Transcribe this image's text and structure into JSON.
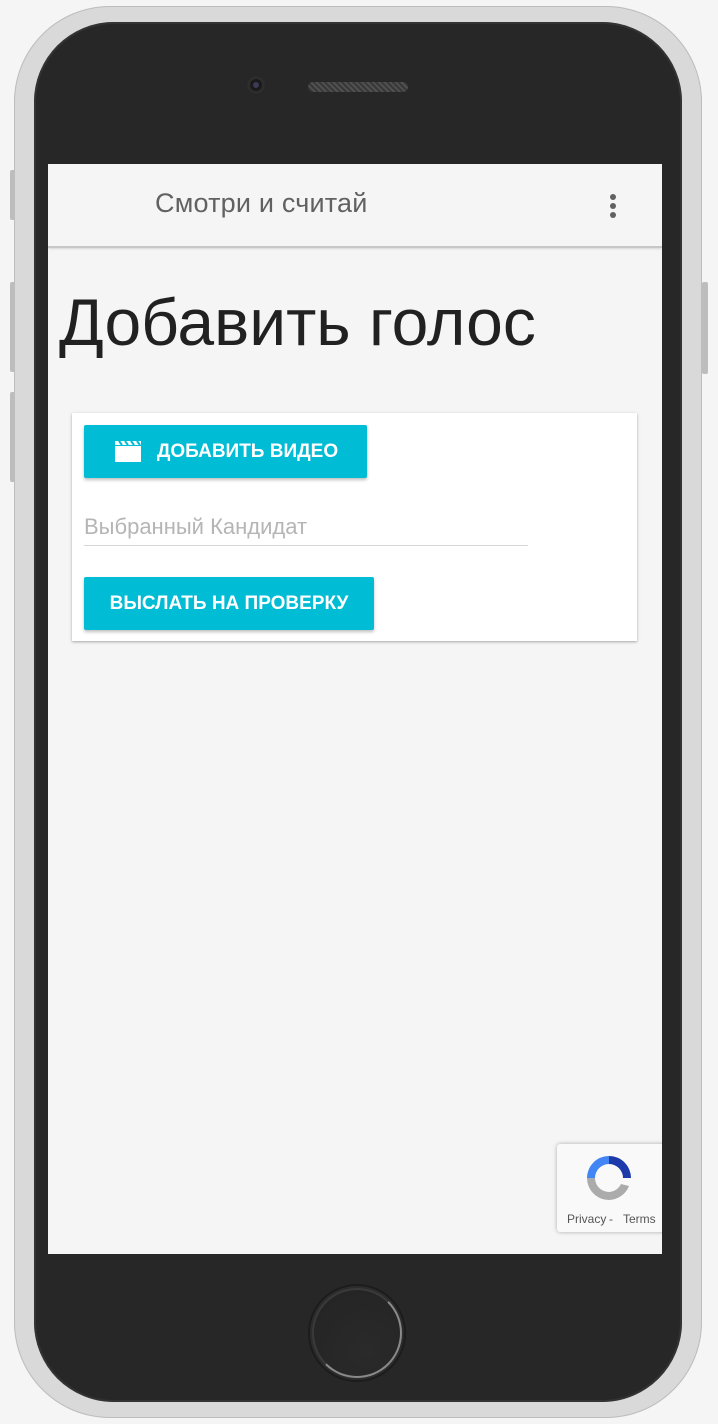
{
  "app_bar": {
    "title": "Смотри и считай",
    "menu_icon": "more-vert-icon"
  },
  "page": {
    "title": "Добавить голос"
  },
  "form": {
    "add_video_button": {
      "label": "ДОБАВИТЬ ВИДЕО",
      "icon": "movie-clapper-icon"
    },
    "candidate_field": {
      "value": "",
      "placeholder": "Выбранный Кандидат"
    },
    "submit_button": {
      "label": "ВЫСЛАТЬ НА ПРОВЕРКУ"
    }
  },
  "recaptcha": {
    "privacy_label": "Privacy",
    "separator": "-",
    "terms_label": "Terms"
  },
  "colors": {
    "accent": "#00bcd4",
    "screen_background": "#f5f5f5",
    "phone_body": "#272727"
  }
}
